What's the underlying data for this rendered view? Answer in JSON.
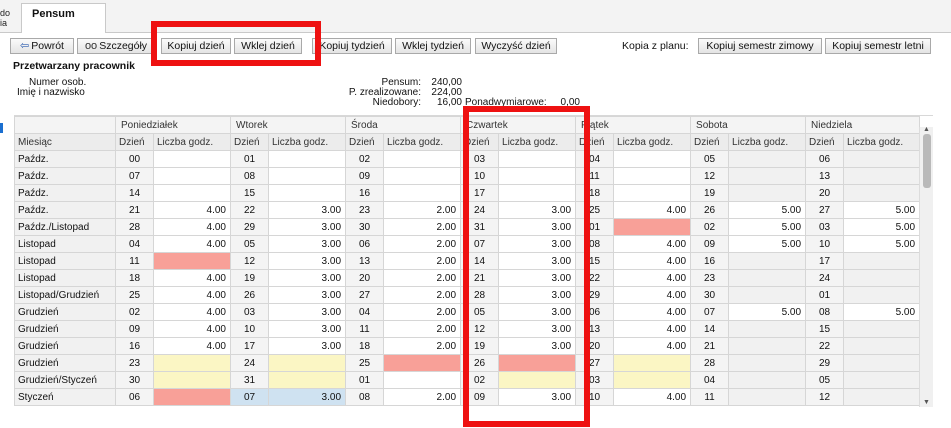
{
  "left_stub": [
    "do",
    "ia"
  ],
  "tab": {
    "label": "Pensum"
  },
  "toolbar": {
    "back": "Powrót",
    "details": "Szczegóły",
    "copy_day": "Kopiuj dzień",
    "paste_day": "Wklej dzień",
    "copy_week": "Kopiuj tydzień",
    "paste_week": "Wklej tydzień",
    "clear_day": "Wyczyść dzień",
    "kopia_label": "Kopia z planu:",
    "copy_winter": "Kopiuj semestr zimowy",
    "copy_summer": "Kopiuj semestr letni"
  },
  "section": {
    "title": "Przetwarzany pracownik"
  },
  "employee": {
    "number_label": "Numer osob.",
    "name_label": "Imię i nazwisko"
  },
  "summary": {
    "pensum_label": "Pensum:",
    "pensum_value": "240,00",
    "realized_label": "P. zrealizowane:",
    "realized_value": "224,00",
    "shortage_label": "Niedobory:",
    "shortage_value": "16,00",
    "overtime_label": "Ponadwymiarowe:",
    "overtime_value": "0,00"
  },
  "grid": {
    "month_header": "Miesiąc",
    "days": [
      "Poniedziałek",
      "Wtorek",
      "Środa",
      "Czwartek",
      "Piątek",
      "Sobota",
      "Niedziela"
    ],
    "day_col": "Dzień",
    "hours_col": "Liczba godz.",
    "rows": [
      {
        "month": "Paźdz.",
        "cells": [
          [
            "00",
            ""
          ],
          [
            "01",
            ""
          ],
          [
            "02",
            ""
          ],
          [
            "03",
            ""
          ],
          [
            "04",
            ""
          ],
          [
            "05",
            ""
          ],
          [
            "06",
            ""
          ]
        ]
      },
      {
        "month": "Paźdz.",
        "cells": [
          [
            "07",
            ""
          ],
          [
            "08",
            ""
          ],
          [
            "09",
            ""
          ],
          [
            "10",
            ""
          ],
          [
            "11",
            ""
          ],
          [
            "12",
            ""
          ],
          [
            "13",
            ""
          ]
        ]
      },
      {
        "month": "Paźdz.",
        "cells": [
          [
            "14",
            ""
          ],
          [
            "15",
            ""
          ],
          [
            "16",
            ""
          ],
          [
            "17",
            ""
          ],
          [
            "18",
            ""
          ],
          [
            "19",
            ""
          ],
          [
            "20",
            ""
          ]
        ]
      },
      {
        "month": "Paźdz.",
        "cells": [
          [
            "21",
            "4.00"
          ],
          [
            "22",
            "3.00"
          ],
          [
            "23",
            "2.00"
          ],
          [
            "24",
            "3.00"
          ],
          [
            "25",
            "4.00"
          ],
          [
            "26",
            "5.00"
          ],
          [
            "27",
            "5.00"
          ]
        ]
      },
      {
        "month": "Paźdz./Listopad",
        "cells": [
          [
            "28",
            "4.00"
          ],
          [
            "29",
            "3.00"
          ],
          [
            "30",
            "2.00"
          ],
          [
            "31",
            "3.00"
          ],
          [
            "01",
            ""
          ],
          [
            "02",
            "5.00"
          ],
          [
            "03",
            "5.00"
          ]
        ]
      },
      {
        "month": "Listopad",
        "cells": [
          [
            "04",
            "4.00"
          ],
          [
            "05",
            "3.00"
          ],
          [
            "06",
            "2.00"
          ],
          [
            "07",
            "3.00"
          ],
          [
            "08",
            "4.00"
          ],
          [
            "09",
            "5.00"
          ],
          [
            "10",
            "5.00"
          ]
        ]
      },
      {
        "month": "Listopad",
        "cells": [
          [
            "11",
            ""
          ],
          [
            "12",
            "3.00"
          ],
          [
            "13",
            "2.00"
          ],
          [
            "14",
            "3.00"
          ],
          [
            "15",
            "4.00"
          ],
          [
            "16",
            ""
          ],
          [
            "17",
            ""
          ]
        ]
      },
      {
        "month": "Listopad",
        "cells": [
          [
            "18",
            "4.00"
          ],
          [
            "19",
            "3.00"
          ],
          [
            "20",
            "2.00"
          ],
          [
            "21",
            "3.00"
          ],
          [
            "22",
            "4.00"
          ],
          [
            "23",
            ""
          ],
          [
            "24",
            ""
          ]
        ]
      },
      {
        "month": "Listopad/Grudzień",
        "cells": [
          [
            "25",
            "4.00"
          ],
          [
            "26",
            "3.00"
          ],
          [
            "27",
            "2.00"
          ],
          [
            "28",
            "3.00"
          ],
          [
            "29",
            "4.00"
          ],
          [
            "30",
            ""
          ],
          [
            "01",
            ""
          ]
        ]
      },
      {
        "month": "Grudzień",
        "cells": [
          [
            "02",
            "4.00"
          ],
          [
            "03",
            "3.00"
          ],
          [
            "04",
            "2.00"
          ],
          [
            "05",
            "3.00"
          ],
          [
            "06",
            "4.00"
          ],
          [
            "07",
            "5.00"
          ],
          [
            "08",
            "5.00"
          ]
        ]
      },
      {
        "month": "Grudzień",
        "cells": [
          [
            "09",
            "4.00"
          ],
          [
            "10",
            "3.00"
          ],
          [
            "11",
            "2.00"
          ],
          [
            "12",
            "3.00"
          ],
          [
            "13",
            "4.00"
          ],
          [
            "14",
            ""
          ],
          [
            "15",
            ""
          ]
        ]
      },
      {
        "month": "Grudzień",
        "cells": [
          [
            "16",
            "4.00"
          ],
          [
            "17",
            "3.00"
          ],
          [
            "18",
            "2.00"
          ],
          [
            "19",
            "3.00"
          ],
          [
            "20",
            "4.00"
          ],
          [
            "21",
            ""
          ],
          [
            "22",
            ""
          ]
        ]
      },
      {
        "month": "Grudzień",
        "cells": [
          [
            "23",
            ""
          ],
          [
            "24",
            ""
          ],
          [
            "25",
            ""
          ],
          [
            "26",
            ""
          ],
          [
            "27",
            ""
          ],
          [
            "28",
            ""
          ],
          [
            "29",
            ""
          ]
        ]
      },
      {
        "month": "Grudzień/Styczeń",
        "cells": [
          [
            "30",
            ""
          ],
          [
            "31",
            ""
          ],
          [
            "01",
            ""
          ],
          [
            "02",
            ""
          ],
          [
            "03",
            ""
          ],
          [
            "04",
            ""
          ],
          [
            "05",
            ""
          ]
        ]
      },
      {
        "month": "Styczeń",
        "cells": [
          [
            "06",
            ""
          ],
          [
            "07",
            "3.00"
          ],
          [
            "08",
            "2.00"
          ],
          [
            "09",
            "3.00"
          ],
          [
            "10",
            "4.00"
          ],
          [
            "11",
            ""
          ],
          [
            "12",
            ""
          ]
        ]
      }
    ],
    "cell_colors": [
      [
        "w",
        "w",
        "w",
        "w",
        "w",
        "g",
        "g"
      ],
      [
        "w",
        "w",
        "w",
        "w",
        "w",
        "g",
        "g"
      ],
      [
        "w",
        "w",
        "w",
        "w",
        "w",
        "g",
        "g"
      ],
      [
        "w",
        "w",
        "w",
        "w",
        "w",
        "w",
        "w"
      ],
      [
        "w",
        "w",
        "w",
        "w",
        "s",
        "w",
        "w"
      ],
      [
        "w",
        "w",
        "w",
        "w",
        "w",
        "w",
        "w"
      ],
      [
        "s",
        "w",
        "w",
        "w",
        "w",
        "g",
        "g"
      ],
      [
        "w",
        "w",
        "w",
        "w",
        "w",
        "g",
        "g"
      ],
      [
        "w",
        "w",
        "w",
        "w",
        "w",
        "g",
        "g"
      ],
      [
        "w",
        "w",
        "w",
        "w",
        "w",
        "w",
        "w"
      ],
      [
        "w",
        "w",
        "w",
        "w",
        "w",
        "g",
        "g"
      ],
      [
        "w",
        "w",
        "w",
        "w",
        "w",
        "g",
        "g"
      ],
      [
        "y",
        "y",
        "s",
        "s",
        "y",
        "g",
        "g"
      ],
      [
        "y",
        "y",
        "w",
        "y",
        "y",
        "g",
        "g"
      ],
      [
        "s",
        "b",
        "w",
        "w",
        "w",
        "g",
        "g"
      ]
    ]
  },
  "colors": {
    "salmon": "#f8a098",
    "yellow": "#fbf6c4",
    "blue": "#cfe2f1",
    "highlight": "#ee1111"
  }
}
